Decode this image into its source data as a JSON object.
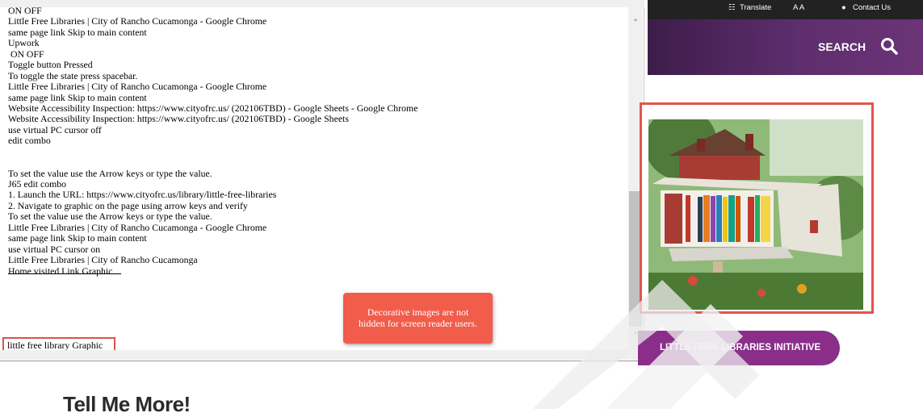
{
  "viewer": {
    "lines": [
      "ON OFF",
      "Little Free Libraries | City of Rancho Cucamonga - Google Chrome",
      "same page link Skip to main content",
      "Upwork",
      " ON OFF",
      "Toggle button Pressed",
      "To toggle the state press spacebar.",
      "Little Free Libraries | City of Rancho Cucamonga - Google Chrome",
      "same page link Skip to main content",
      "Website Accessibility Inspection: https://www.cityofrc.us/ (202106TBD) - Google Sheets - Google Chrome",
      "Website Accessibility Inspection: https://www.cityofrc.us/ (202106TBD) - Google Sheets",
      "use virtual PC cursor off",
      "edit combo",
      "",
      "",
      "To set the value use the Arrow keys or type the value.",
      "J65 edit combo",
      "1. Launch the URL: https://www.cityofrc.us/library/little-free-libraries",
      "2. Navigate to graphic on the page using arrow keys and verify",
      "To set the value use the Arrow keys or type the value.",
      "Little Free Libraries | City of Rancho Cucamonga - Google Chrome",
      "same page link Skip to main content",
      "use virtual PC cursor on",
      "Little Free Libraries | City of Rancho Cucamonga",
      "Home visited Link Graphic"
    ],
    "highlighted_line": "little free library Graphic"
  },
  "callout": {
    "text": "Decorative images are not hidden for screen reader users."
  },
  "page": {
    "heading": "Tell Me More!"
  },
  "site": {
    "translate": "Translate",
    "text_size": "A A",
    "contact": "Contact Us",
    "search_label": "SEARCH",
    "cta_label": "LITTLE FREE LIBRARIES INITIATIVE"
  },
  "colors": {
    "callout": "#f25c4a",
    "highlight_border": "#d9534f",
    "purple_bar": "#5e2e6e",
    "cta": "#8a2e8a",
    "top_bar": "#222222"
  },
  "icons": [
    "translate-icon",
    "speech-bubble-icon",
    "search-icon",
    "scroll-up-icon",
    "scroll-down-icon"
  ]
}
